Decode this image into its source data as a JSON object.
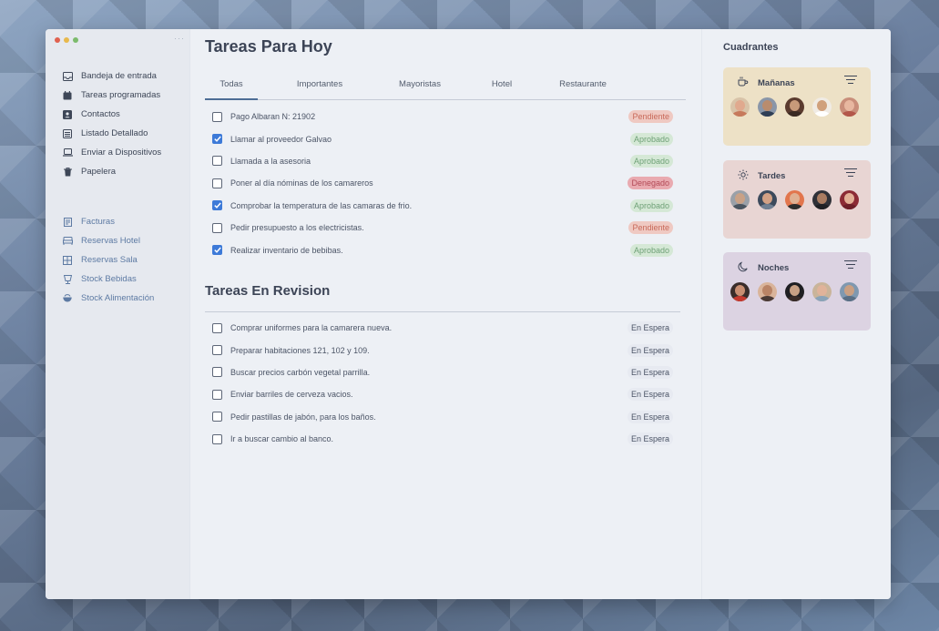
{
  "sidebar": {
    "primary": [
      {
        "label": "Bandeja de entrada",
        "icon": "inbox-icon"
      },
      {
        "label": "Tareas programadas",
        "icon": "calendar-icon"
      },
      {
        "label": "Contactos",
        "icon": "contact-card-icon"
      },
      {
        "label": "Listado Detallado",
        "icon": "list-detail-icon"
      },
      {
        "label": "Enviar a Dispositivos",
        "icon": "laptop-icon"
      },
      {
        "label": "Papelera",
        "icon": "trash-icon"
      }
    ],
    "secondary": [
      {
        "label": "Facturas",
        "icon": "invoice-icon"
      },
      {
        "label": "Reservas Hotel",
        "icon": "bed-icon"
      },
      {
        "label": "Reservas Sala",
        "icon": "room-grid-icon"
      },
      {
        "label": "Stock Bebidas",
        "icon": "cup-icon"
      },
      {
        "label": "Stock Alimentación",
        "icon": "bowl-icon"
      }
    ]
  },
  "main": {
    "title": "Tareas Para Hoy",
    "tabs": [
      "Todas",
      "Importantes",
      "Mayoristas",
      "Hotel",
      "Restaurante"
    ],
    "tasks": [
      {
        "text": "Pago Albaran N: 21902",
        "checked": false,
        "status": "Pendiente",
        "type": "pend"
      },
      {
        "text": "Llamar al proveedor Galvao",
        "checked": true,
        "status": "Aprobado",
        "type": "apro"
      },
      {
        "text": "Llamada a la asesoria",
        "checked": false,
        "status": "Aprobado",
        "type": "apro"
      },
      {
        "text": "Poner al día nóminas de los camareros",
        "checked": false,
        "status": "Denegado",
        "type": "den"
      },
      {
        "text": "Comprobar la temperatura de las camaras de frio.",
        "checked": true,
        "status": "Aprobado",
        "type": "apro"
      },
      {
        "text": "Pedir presupuesto a los electricistas.",
        "checked": false,
        "status": "Pendiente",
        "type": "pend"
      },
      {
        "text": "Realizar inventario de bebibas.",
        "checked": true,
        "status": "Aprobado",
        "type": "apro"
      }
    ],
    "review_title": "Tareas En Revision",
    "review_tasks": [
      {
        "text": "Comprar uniformes para la camarera nueva.",
        "checked": false,
        "status": "En Espera",
        "type": "esp"
      },
      {
        "text": "Preparar habitaciones 121, 102 y 109.",
        "checked": false,
        "status": "En Espera",
        "type": "esp"
      },
      {
        "text": "Buscar precios carbón vegetal parrilla.",
        "checked": false,
        "status": "En Espera",
        "type": "esp"
      },
      {
        "text": "Enviar barriles de cerveza vacios.",
        "checked": false,
        "status": "En Espera",
        "type": "esp"
      },
      {
        "text": "Pedir pastillas de jabón, para los baños.",
        "checked": false,
        "status": "En Espera",
        "type": "esp"
      },
      {
        "text": "Ir a buscar cambio al banco.",
        "checked": false,
        "status": "En Espera",
        "type": "esp"
      }
    ]
  },
  "right": {
    "title": "Cuadrantes",
    "cards": [
      {
        "label": "Mañanas",
        "icon": "coffee-icon",
        "color": "#ede1c6"
      },
      {
        "label": "Tardes",
        "icon": "sun-icon",
        "color": "#e8d5d3"
      },
      {
        "label": "Noches",
        "icon": "moon-icon",
        "color": "#dcd3e2"
      }
    ]
  }
}
